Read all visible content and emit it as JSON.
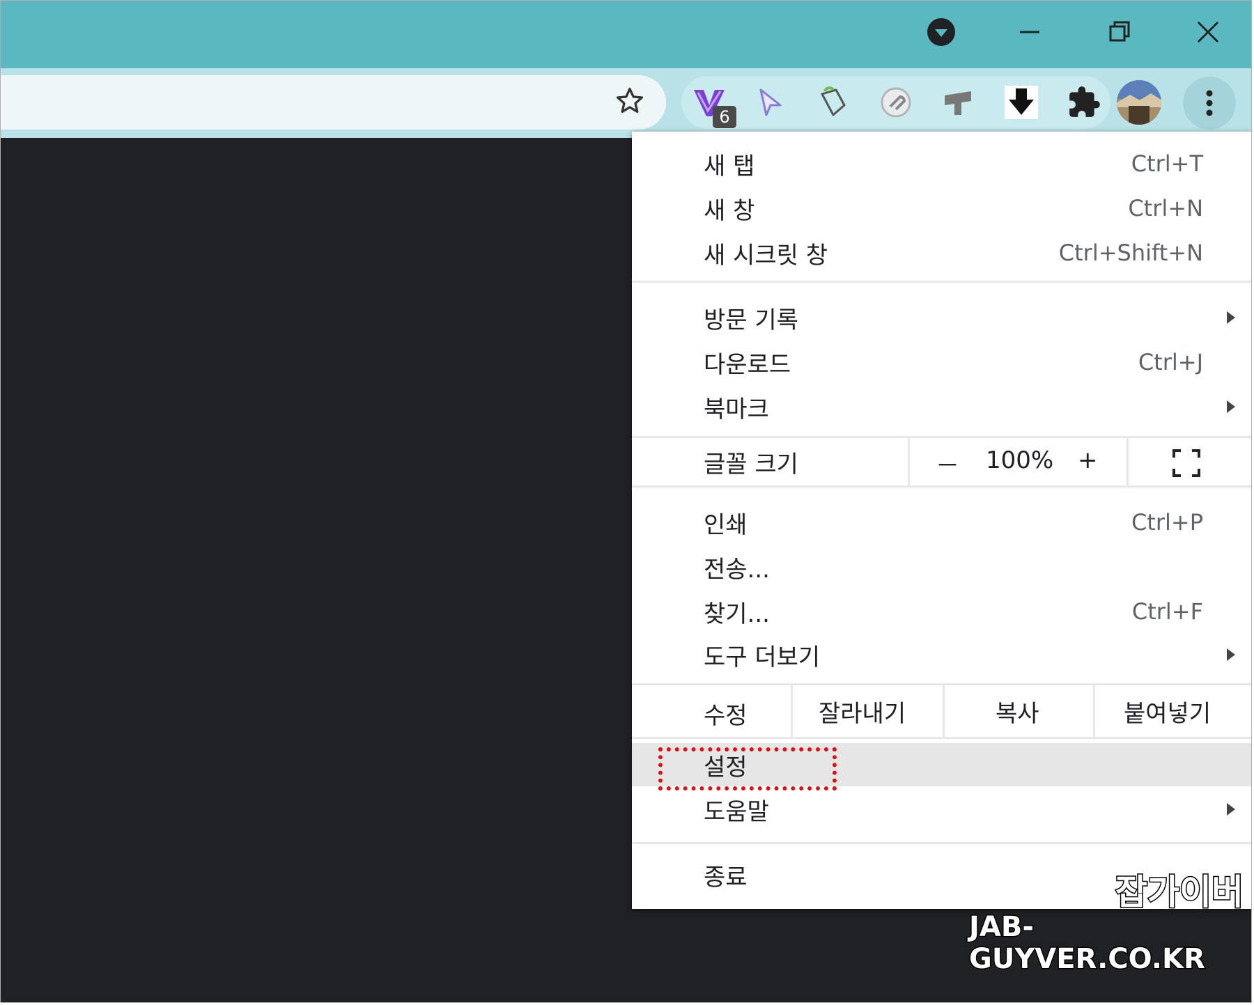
{
  "menu": {
    "items_group1": [
      {
        "label": "새 탭",
        "shortcut": "Ctrl+T"
      },
      {
        "label": "새 창",
        "shortcut": "Ctrl+N"
      },
      {
        "label": "새 시크릿 창",
        "shortcut": "Ctrl+Shift+N"
      }
    ],
    "items_group2": [
      {
        "label": "방문 기록",
        "shortcut": ""
      },
      {
        "label": "다운로드",
        "shortcut": "Ctrl+J"
      },
      {
        "label": "북마크",
        "shortcut": ""
      }
    ],
    "zoom": {
      "label": "글꼴 크기",
      "minus": "－",
      "value": "100%",
      "plus": "+"
    },
    "items_group3": [
      {
        "label": "인쇄",
        "shortcut": "Ctrl+P"
      },
      {
        "label": "전송...",
        "shortcut": ""
      },
      {
        "label": "찾기...",
        "shortcut": "Ctrl+F"
      },
      {
        "label": "도구 더보기",
        "shortcut": ""
      }
    ],
    "edit": {
      "label": "수정",
      "cut": "잘라내기",
      "copy": "복사",
      "paste": "붙여넣기"
    },
    "items_group4": [
      {
        "label": "설정"
      },
      {
        "label": "도움말"
      }
    ],
    "exit": {
      "label": "종료"
    }
  },
  "extensions": {
    "badge_count": "6"
  },
  "watermark": {
    "line1": "잡가이버",
    "line2": "JAB-GUYVER.CO.KR"
  },
  "colors": {
    "titlebar": "#5ab8c1",
    "toolbar": "#b9e2e8",
    "content": "#202124",
    "highlight_box": "#e01010"
  }
}
